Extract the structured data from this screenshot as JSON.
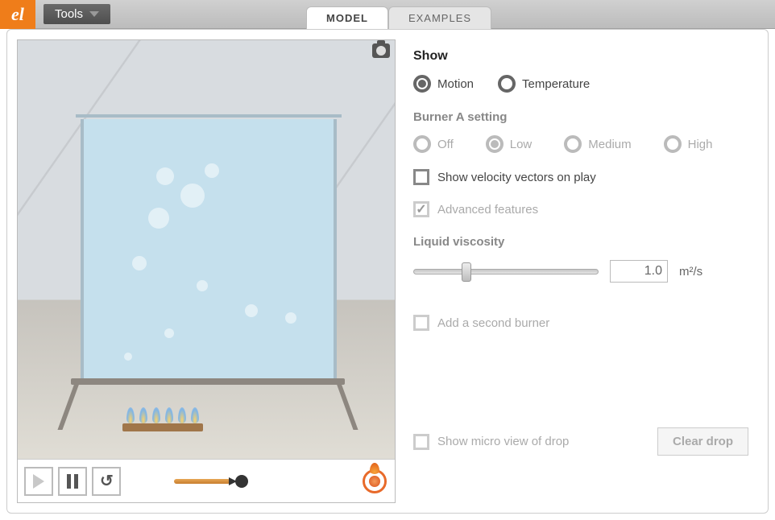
{
  "topbar": {
    "tools_label": "Tools",
    "logo_text": "el"
  },
  "tabs": {
    "model": "MODEL",
    "examples": "EXAMPLES",
    "active": "model"
  },
  "controls": {
    "show_title": "Show",
    "show_options": {
      "motion": "Motion",
      "temperature": "Temperature"
    },
    "show_selected": "motion",
    "burner_title": "Burner A setting",
    "burner_options": {
      "off": "Off",
      "low": "Low",
      "medium": "Medium",
      "high": "High"
    },
    "burner_selected": "low",
    "velocity_label": "Show velocity vectors on play",
    "velocity_checked": false,
    "advanced_label": "Advanced features",
    "advanced_checked": true,
    "viscosity_title": "Liquid viscosity",
    "viscosity_value": "1.0",
    "viscosity_unit": "m²/s",
    "second_burner_label": "Add a second burner",
    "second_burner_checked": false,
    "micro_label": "Show micro view of drop",
    "micro_checked": false,
    "clear_label": "Clear drop"
  }
}
